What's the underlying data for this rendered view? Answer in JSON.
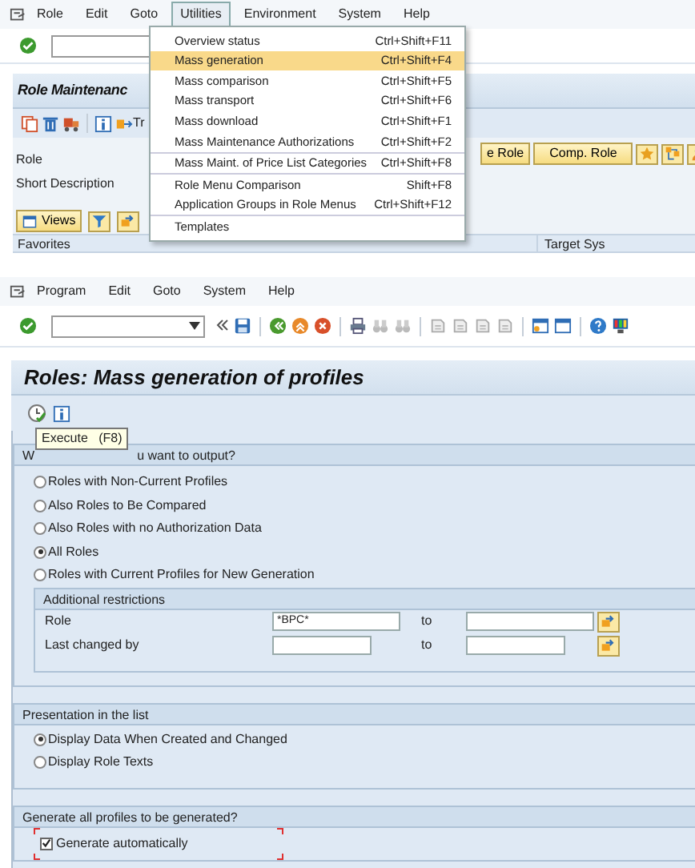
{
  "top_screen": {
    "menu_bar": [
      {
        "label": "Role",
        "selected": false
      },
      {
        "label": "Edit",
        "selected": false
      },
      {
        "label": "Goto",
        "selected": false
      },
      {
        "label": "Utilities",
        "selected": true
      },
      {
        "label": "Environment",
        "selected": false
      },
      {
        "label": "System",
        "selected": false
      },
      {
        "label": "Help",
        "selected": false
      }
    ],
    "title": "Role Maintenanc",
    "toolbar_text": "Tr",
    "fields": [
      {
        "label": "Role"
      },
      {
        "label": "Short Description"
      }
    ],
    "buttons": [
      "e Role",
      "Comp. Role"
    ],
    "views_button": "Views",
    "columns": [
      "Favorites",
      "Target Sys"
    ],
    "dropdown": [
      {
        "label": "Overview status",
        "shortcut": "Ctrl+Shift+F11",
        "selected": false,
        "separator_before": false
      },
      {
        "label": "Mass generation",
        "shortcut": "Ctrl+Shift+F4",
        "selected": true,
        "separator_before": false
      },
      {
        "label": "Mass comparison",
        "shortcut": "Ctrl+Shift+F5",
        "selected": false,
        "separator_before": false
      },
      {
        "label": "Mass transport",
        "shortcut": "Ctrl+Shift+F6",
        "selected": false,
        "separator_before": false
      },
      {
        "label": "Mass download",
        "shortcut": "Ctrl+Shift+F1",
        "selected": false,
        "separator_before": false
      },
      {
        "label": "Mass Maintenance Authorizations",
        "shortcut": "Ctrl+Shift+F2",
        "selected": false,
        "separator_before": false
      },
      {
        "label": "Mass Maint. of Price List Categories",
        "shortcut": "Ctrl+Shift+F8",
        "selected": false,
        "separator_before": true
      },
      {
        "label": "Role Menu Comparison",
        "shortcut": "Shift+F8",
        "selected": false,
        "separator_before": true
      },
      {
        "label": "Application Groups in Role Menus",
        "shortcut": "Ctrl+Shift+F12",
        "selected": false,
        "separator_before": false
      },
      {
        "label": "Templates",
        "selected": false,
        "separator_before": true
      }
    ]
  },
  "bottom_screen": {
    "menu_bar": [
      "Program",
      "Edit",
      "Goto",
      "System",
      "Help"
    ],
    "title": "Roles: Mass generation of profiles",
    "tooltip": {
      "label": "Execute",
      "shortcut": "(F8)"
    },
    "output_group": {
      "title_start": "W",
      "title_end": "u want to output?",
      "options": [
        {
          "label": "Roles with Non-Current Profiles",
          "selected": false
        },
        {
          "label": "Also Roles to Be Compared",
          "selected": false
        },
        {
          "label": "Also Roles with no Authorization Data",
          "selected": false
        },
        {
          "label": "All Roles",
          "selected": true
        },
        {
          "label": "Roles with Current Profiles for New Generation",
          "selected": false
        }
      ],
      "restrictions": {
        "title": "Additional restrictions",
        "rows": [
          {
            "label": "Role",
            "from": "*BPC*",
            "to_label": "to"
          },
          {
            "label": "Last changed by",
            "to_label": "to"
          }
        ]
      }
    },
    "presentation": {
      "title": "Presentation in the list",
      "options": [
        {
          "label": "Display Data When Created and Changed",
          "selected": true
        },
        {
          "label": "Display Role Texts",
          "selected": false
        }
      ]
    },
    "generation": {
      "title": "Generate all profiles to be generated?",
      "checkbox": {
        "label": "Generate automatically",
        "checked": true,
        "focused": true
      }
    }
  }
}
